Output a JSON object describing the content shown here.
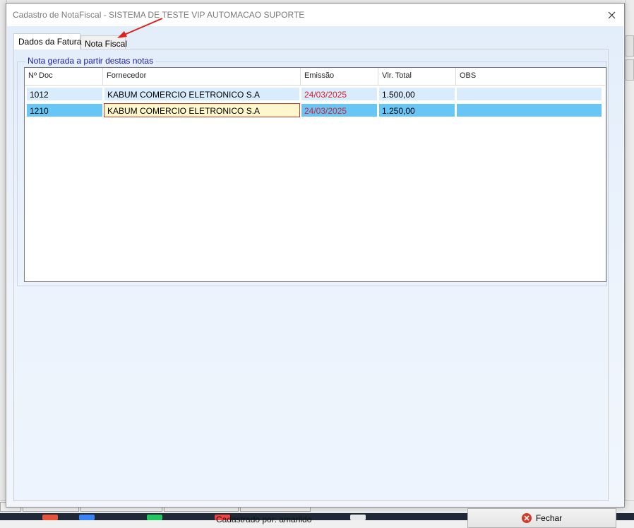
{
  "dialog": {
    "title": "Cadastro de NotaFiscal - SISTEMA DE TESTE VIP AUTOMACAO SUPORTE"
  },
  "tabs": [
    {
      "label": "Dados da Fatura",
      "active": true
    },
    {
      "label": "Nota Fiscal",
      "active": false
    }
  ],
  "group": {
    "title": "Nota gerada a partir destas notas"
  },
  "grid": {
    "columns": [
      "Nº Doc",
      "Fornecedor",
      "Emissão",
      "Vlr. Total",
      "OBS"
    ],
    "rows": [
      {
        "doc": "1012",
        "fornecedor": "KABUM COMERCIO ELETRONICO S.A",
        "emissao": "24/03/2025",
        "total": "1.500,00",
        "obs": "",
        "selected": false
      },
      {
        "doc": "1210",
        "fornecedor": "KABUM COMERCIO ELETRONICO S.A",
        "emissao": "24/03/2025",
        "total": "1.250,00",
        "obs": "",
        "selected": true
      }
    ]
  },
  "footer": {
    "created_by": "Cadastrado por: amarildo",
    "close_label": "Fechar"
  },
  "colors": {
    "accent": "#1a1aa6",
    "date_text": "#d9202e",
    "row_selected": "#67c6f5",
    "row_normal": "#d9ecfb",
    "annotation_arrow": "#e0201a"
  },
  "icons": {
    "close": "close-icon",
    "fechar": "x-circle-icon"
  }
}
